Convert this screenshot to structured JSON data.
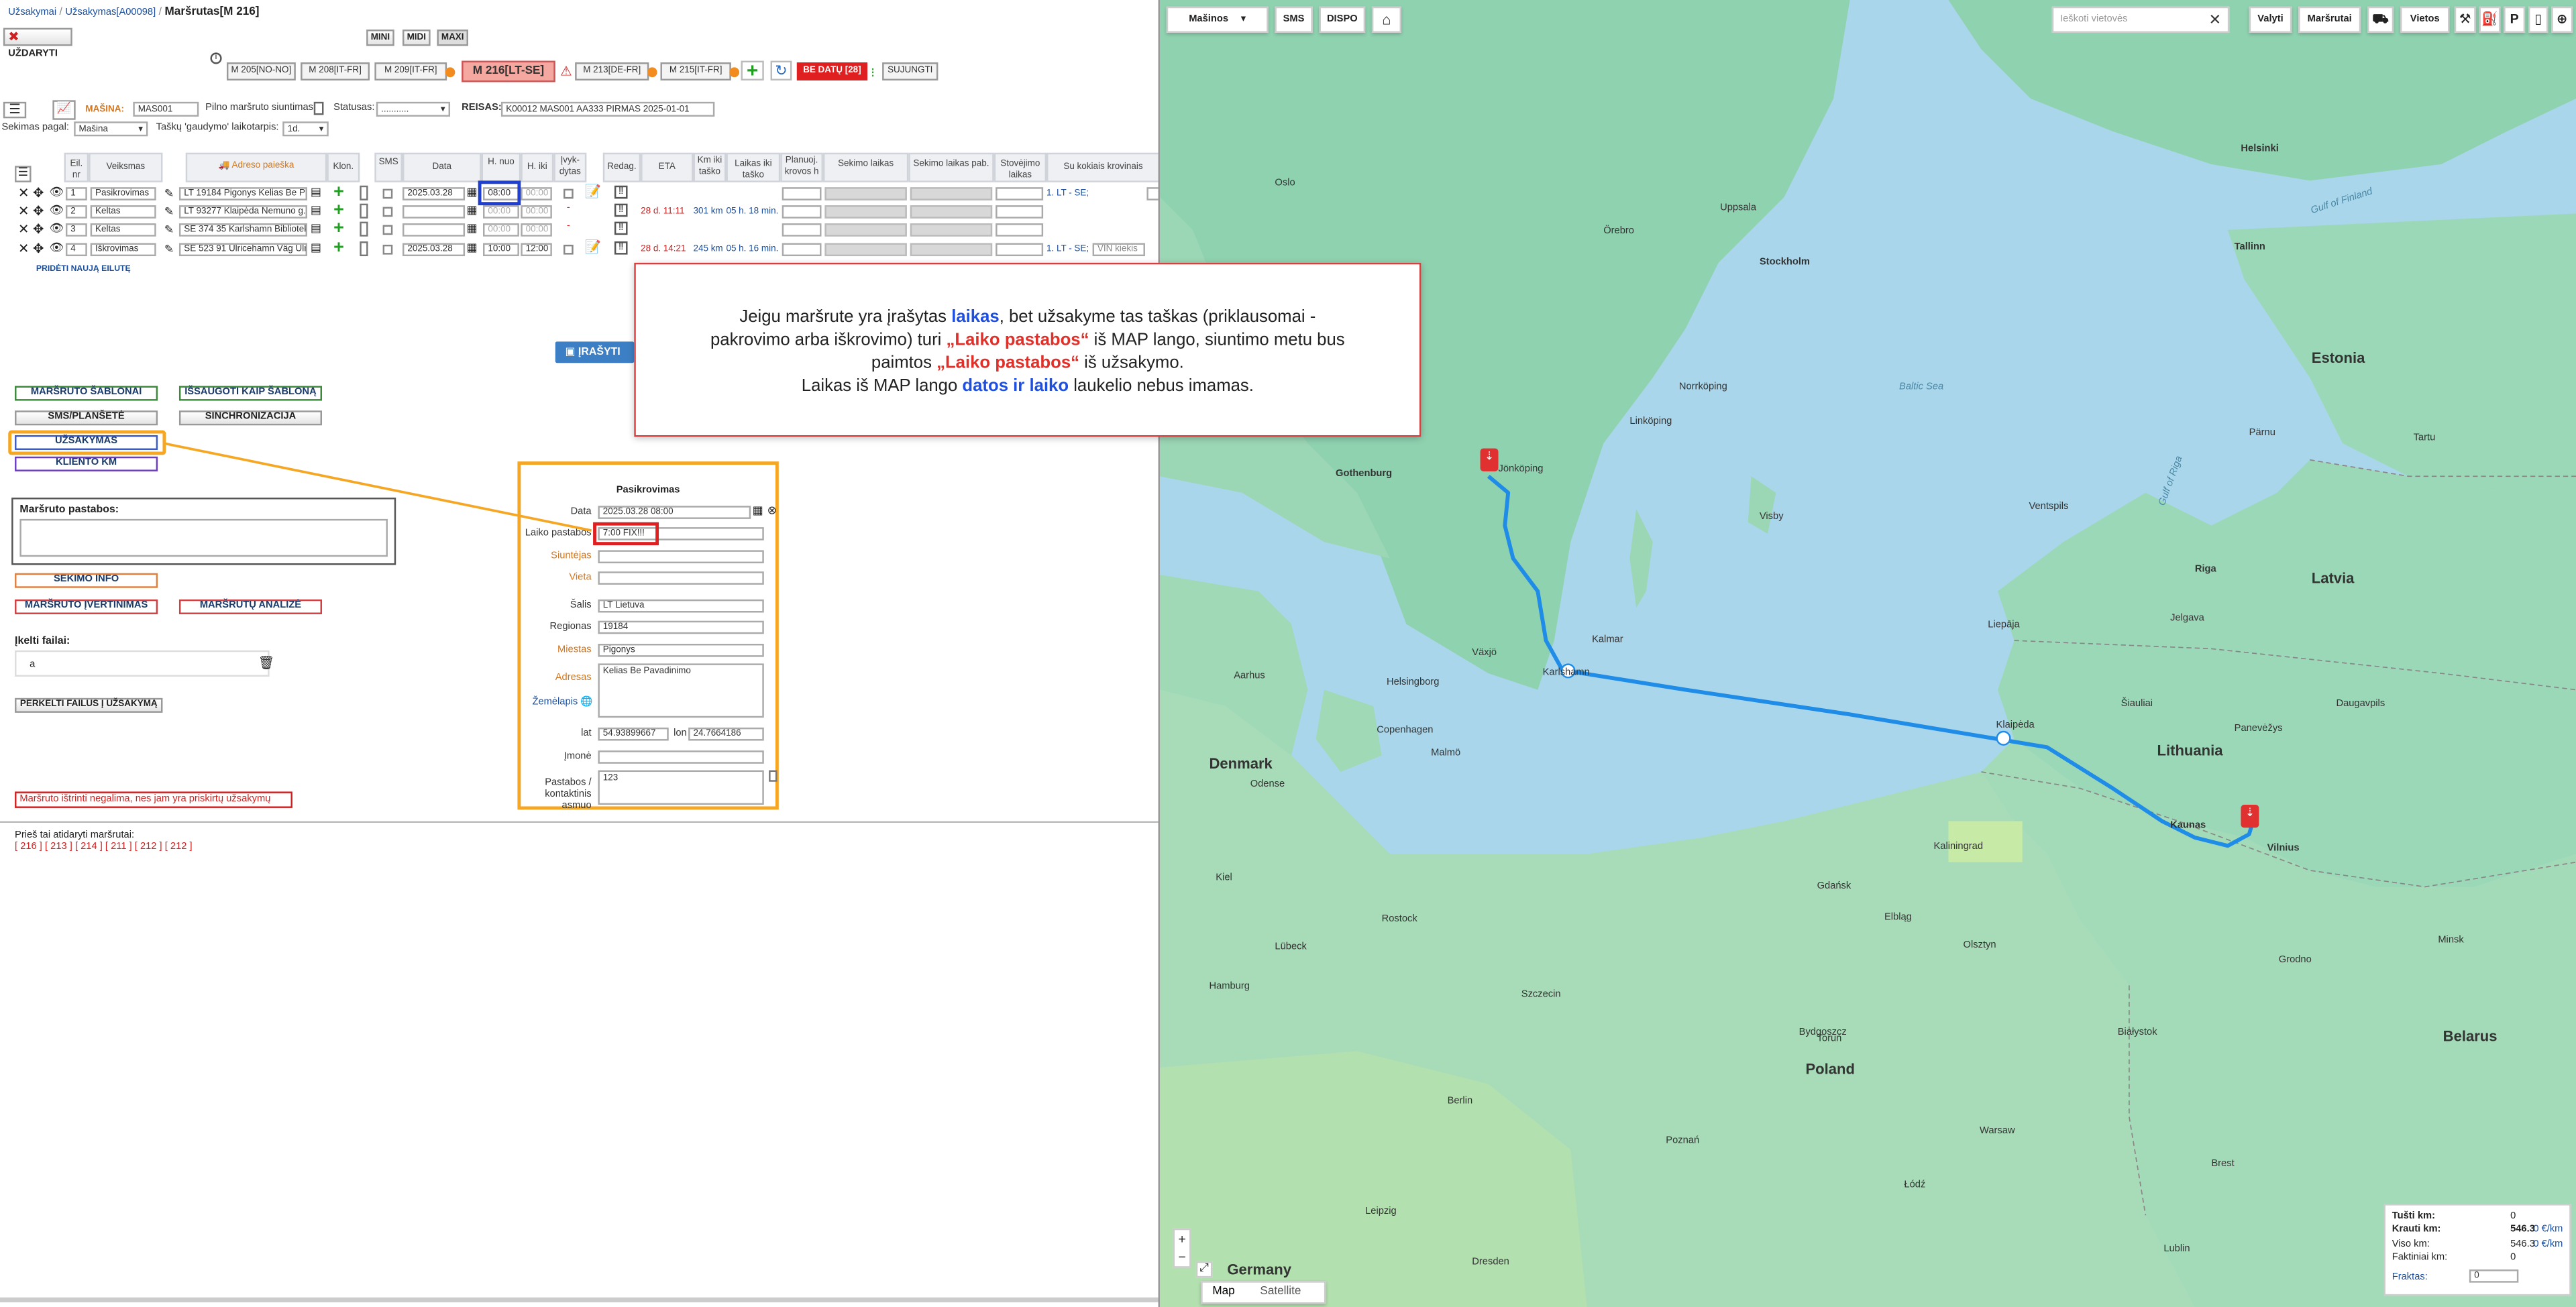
{
  "breadcrumb": {
    "item1": "Užsakymai",
    "item2": "Užsakymas[A00098]",
    "current": "Maršrutas[M 216]"
  },
  "close_label": "UŽDARYTI",
  "views": [
    "MINI",
    "MIDI",
    "MAXI"
  ],
  "route_tabs": [
    "M 205[NO-NO]",
    "M 208[IT-FR]",
    "M 209[IT-FR]",
    "M 216[LT-SE]",
    "M 213[DE-FR]",
    "M 215[IT-FR]"
  ],
  "be_datu": "BE DATŲ [28]",
  "sujungti": "SUJUNGTI",
  "toolbar": {
    "masina_label": "MAŠINA:",
    "masina_value": "MAS001",
    "pilno": "Pilno maršruto siuntimas",
    "statusas_label": "Statusas:",
    "statusas_value": "...........",
    "reisas_label": "REISAS:",
    "reisas_value": "K00012 MAS001 AA333 PIRMAS 2025-01-01",
    "sekimas_label": "Sekimas pagal:",
    "sekimas_value": "Mašina",
    "taskai_label": "Taškų 'gaudymo' laikotarpis:",
    "taskai_value": "1d."
  },
  "table": {
    "headers": [
      "Eil. nr",
      "Veiksmas",
      "Adreso paieška",
      "Klon.",
      "SMS",
      "Data",
      "H. nuo",
      "H. iki",
      "Įvyk-dytas",
      "Redag.",
      "ETA",
      "Km iki taško",
      "Laikas iki taško",
      "Planuoj. krovos h",
      "Sekimo laikas",
      "Sekimo laikas pab.",
      "Stovėjimo laikas",
      "Su kokiais krovinais"
    ],
    "rows": [
      {
        "nr": "1",
        "action": "Pasikrovimas",
        "address": "LT 19184 Pigonys Kelias Be Pavadinimo",
        "date": "2025.03.28",
        "from": "08:00",
        "to": "00:00",
        "eta": "",
        "km": "",
        "time": "",
        "cargo": "1. LT - SE;"
      },
      {
        "nr": "2",
        "action": "Keltas",
        "address": "LT 93277 Klaipėda Nemuno g.",
        "date": "",
        "from": "00:00",
        "to": "00:00",
        "eta": "28 d. 11:11",
        "km": "301 km",
        "time": "05 h. 18 min.",
        "cargo": ""
      },
      {
        "nr": "3",
        "action": "Keltas",
        "address": "SE 374 35 Karlshamn Biblioteksgatan",
        "date": "",
        "from": "00:00",
        "to": "00:00",
        "eta": "",
        "km": "",
        "time": "",
        "cargo": ""
      },
      {
        "nr": "4",
        "action": "Iškrovimas",
        "address": "SE 523 91 Ulricehamn Väg Ulricehamn",
        "date": "2025.03.28",
        "from": "10:00",
        "to": "12:00",
        "eta": "28 d. 14:21",
        "km": "245 km",
        "time": "05 h. 16 min.",
        "cargo": "1. LT - SE;",
        "cargo_extra": "VIN kiekis"
      }
    ],
    "add_row": "PRIDĖTI NAUJĄ EILUTĘ"
  },
  "save_button": "ĮRAŠYTI",
  "left_buttons": {
    "sablonai": "MARŠRUTO ŠABLONAI",
    "issaugoti": "IŠSAUGOTI KAIP ŠABLONĄ",
    "sms": "SMS/PLANŠETĖ",
    "sinchronizacija": "SINCHRONIZACIJA",
    "uzsakymas": "UŽSAKYMAS",
    "kliento_km": "KLIENTO KM",
    "sekimo_info": "SEKIMO INFO",
    "ivertinimas": "MARŠRUTO ĮVERTINIMAS",
    "analize": "MARŠRUTŲ ANALIZĖ",
    "perkelti": "PERKELTI FAILUS Į UŽSAKYMĄ"
  },
  "pastabos_label": "Maršruto pastabos:",
  "ikelti_label": "Įkelti failai:",
  "file_value": "a",
  "warning": "Maršruto ištrinti negalima, nes jam yra priskirtų užsakymų",
  "prev_label": "Prieš tai atidaryti maršrutai:",
  "prev_routes": [
    "[ 216 ]",
    "[ 213 ]",
    "[ 214 ]",
    "[ 211 ]",
    "[ 212 ]",
    "[ 212 ]"
  ],
  "callout": {
    "l1a": "Jeigu maršrute yra įrašytas ",
    "l1b": "laikas",
    "l1c": ", bet užsakyme tas taškas (priklausomai -",
    "l2a": "pakrovimo arba iškrovimo) turi ",
    "l2b": "„Laiko pastabos“",
    "l2c": " iš MAP lango, siuntimo metu bus",
    "l3a": "paimtos ",
    "l3b": "„Laiko pastabos“",
    "l3c": " iš užsakymo.",
    "l4a": "Laikas iš MAP lango ",
    "l4b": "datos ir laiko",
    "l4c": " laukelio nebus imamas.",
    "accent_blue": "#1f4fe0",
    "accent_red": "#e0302a"
  },
  "popup": {
    "title": "Pasikrovimas",
    "data_label": "Data",
    "data_value": "2025.03.28 08:00",
    "laiko_label": "Laiko pastabos",
    "laiko_value": "7:00 FIX!!!",
    "siuntejas_label": "Siuntėjas",
    "vieta_label": "Vieta",
    "salis_label": "Šalis",
    "salis_value": "LT Lietuva",
    "regionas_label": "Regionas",
    "regionas_value": "19184",
    "miestas_label": "Miestas",
    "miestas_value": "Pigonys",
    "adresas_label": "Adresas",
    "adresas_value": "Kelias Be Pavadinimo",
    "zemelapis_label": "Žemėlapis",
    "lat_label": "lat",
    "lat_value": "54.93899667",
    "lon_label": "lon",
    "lon_value": "24.7664186",
    "imone_label": "Įmonė",
    "kontaktai_label": "Pastabos / kontaktinis asmuo",
    "kontaktai_value": "123"
  },
  "map": {
    "masinos": "Mašinos",
    "sms": "SMS",
    "dispo": "DISPO",
    "search_placeholder": "Ieškoti vietovės",
    "valyti": "Valyti",
    "marsrutai": "Maršrutai",
    "vietos": "Vietos",
    "map_tab": "Map",
    "satellite_tab": "Satellite",
    "countries": [
      "Estonia",
      "Latvia",
      "Lithuania",
      "Denmark",
      "Poland",
      "Belarus",
      "Germany"
    ],
    "seas": [
      "Baltic Sea",
      "Gulf of Finland",
      "Gulf of Riga"
    ],
    "cities": [
      "Oslo",
      "Stockholm",
      "Helsinki",
      "Tallinn",
      "Riga",
      "Vilnius",
      "Kaunas",
      "Klaipėda",
      "Gothenburg",
      "Jönköping",
      "Karlshamn",
      "Malmö",
      "Copenhagen",
      "Gdańsk",
      "Warsaw",
      "Berlin",
      "Hamburg",
      "Szczecin",
      "Minsk",
      "Białystok",
      "Liepāja",
      "Daugavpils",
      "Poznań",
      "Bydgoszcz",
      "Łódź",
      "Dresden",
      "Brest",
      "Grodno",
      "Kaliningrad",
      "Olsztyn",
      "Lublin",
      "Växjö",
      "Kalmar",
      "Helsingborg",
      "Örebro",
      "Uppsala",
      "Norrköping",
      "Linköping",
      "Tartu",
      "Pärnu",
      "Ventspils",
      "Šiauliai",
      "Panevėžys",
      "Jelgava",
      "Elbląg",
      "Toruń",
      "Rostock",
      "Leipzig",
      "Kiel",
      "Lübeck",
      "Odense",
      "Aarhus",
      "Visby"
    ],
    "stats": {
      "tusti_label": "Tušti km:",
      "tusti_value": "0",
      "krauti_label": "Krauti km:",
      "krauti_value": "546.3",
      "krauti_rate": "0 €/km",
      "viso_label": "Viso km:",
      "viso_value": "546.3",
      "viso_rate": "0 €/km",
      "faktiniai_label": "Faktiniai km:",
      "faktiniai_value": "0",
      "fraktas_label": "Fraktas:",
      "fraktas_value": "0"
    }
  }
}
